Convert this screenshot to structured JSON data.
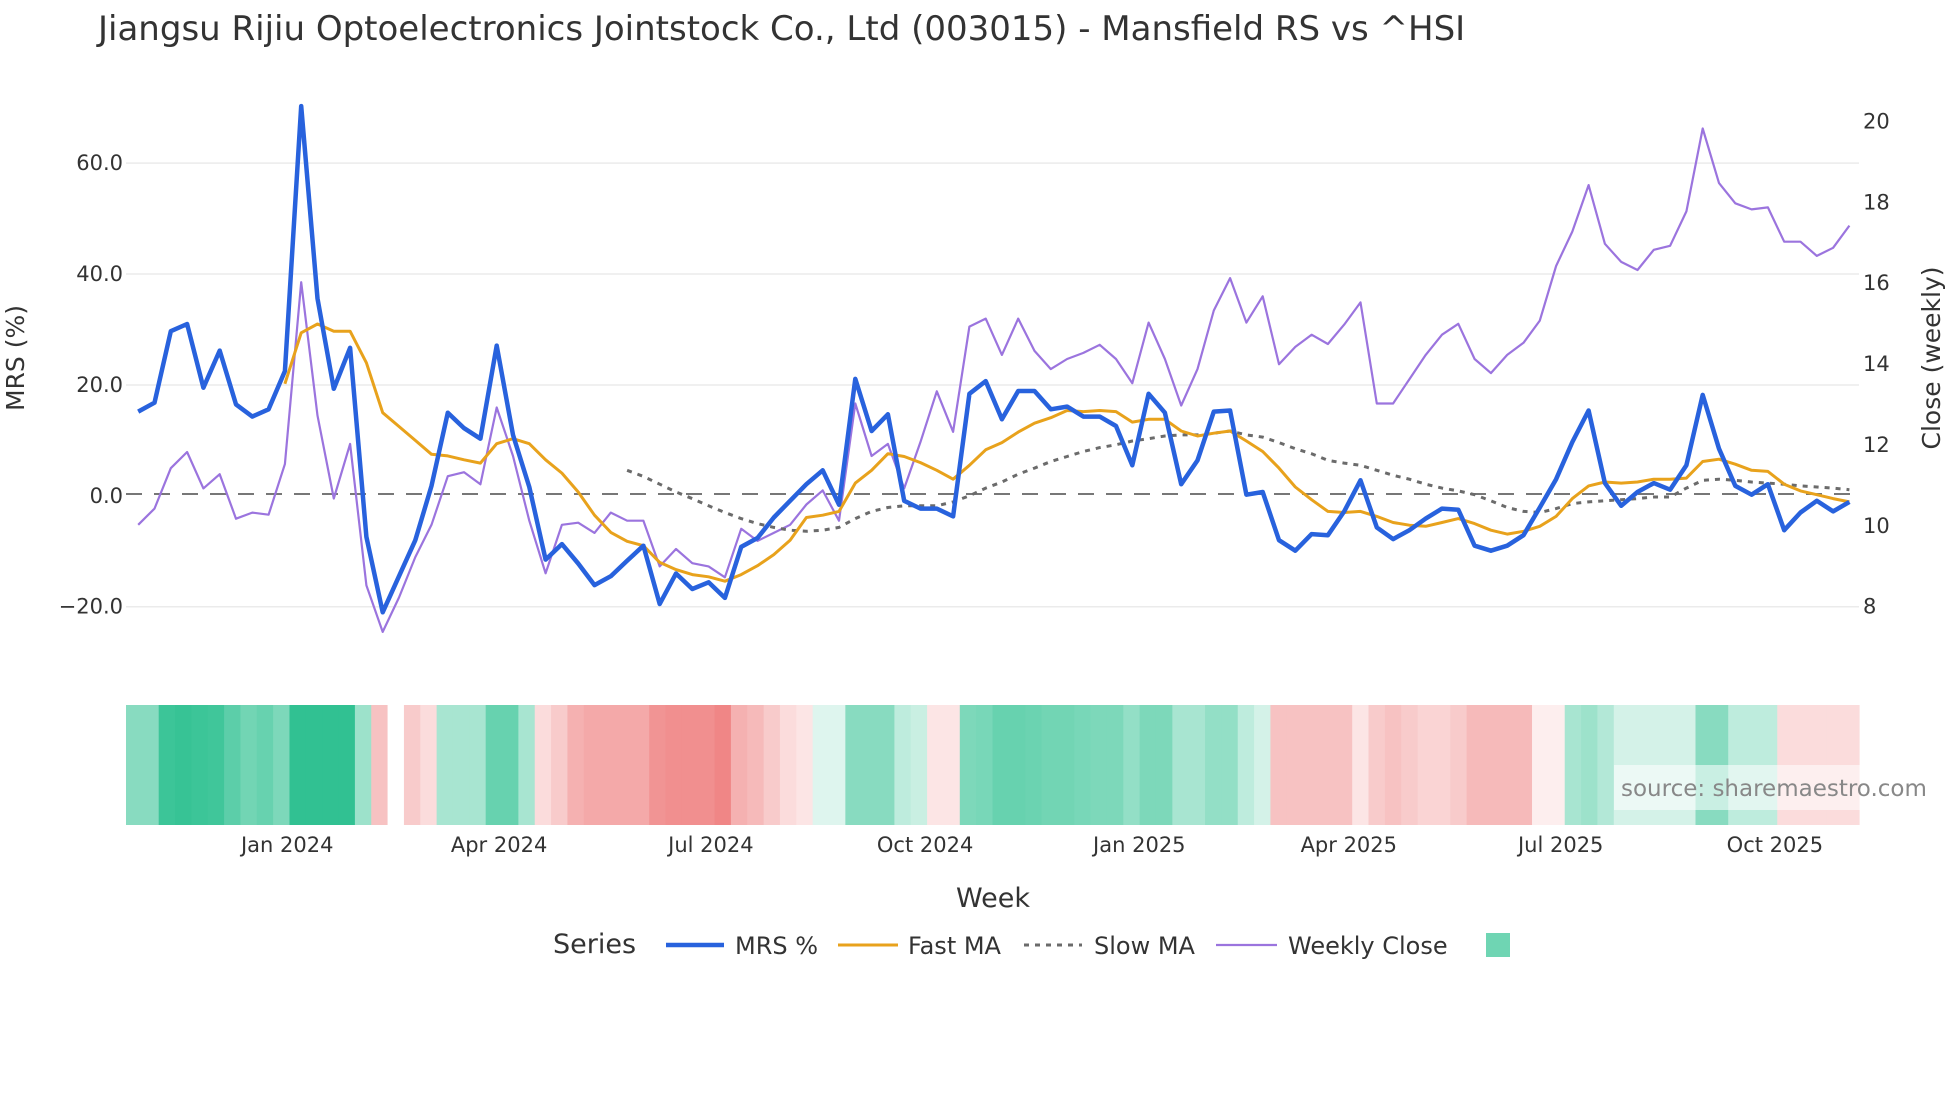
{
  "chart_data": {
    "type": "line",
    "title": "Jiangsu Rijiu Optoelectronics Jointstock Co., Ltd (003015) - Mansfield RS vs ^HSI",
    "xlabel": "Week",
    "ylabel": "MRS (%)",
    "y2label": "Close (weekly)",
    "x_start": "2023-10-29",
    "x_step_days": 7,
    "ylim": [
      -26,
      75
    ],
    "y2lim": [
      7.15,
      21.0
    ],
    "yticks": [
      -20,
      0,
      20,
      40,
      60
    ],
    "ytick_labels": [
      "−20.0",
      "0.0",
      "20.0",
      "40.0",
      "60.0"
    ],
    "y2ticks": [
      8,
      10,
      12,
      14,
      16,
      18,
      20
    ],
    "y2tick_labels": [
      "8",
      "10",
      "12",
      "14",
      "16",
      "18",
      "20"
    ],
    "xticks": [
      {
        "date": "2024-01-01",
        "label": "Jan 2024"
      },
      {
        "date": "2024-04-01",
        "label": "Apr 2024"
      },
      {
        "date": "2024-07-01",
        "label": "Jul 2024"
      },
      {
        "date": "2024-10-01",
        "label": "Oct 2024"
      },
      {
        "date": "2025-01-01",
        "label": "Jan 2025"
      },
      {
        "date": "2025-04-01",
        "label": "Apr 2025"
      },
      {
        "date": "2025-07-01",
        "label": "Jul 2025"
      },
      {
        "date": "2025-10-01",
        "label": "Oct 2025"
      }
    ],
    "grid": true,
    "zero_line": 0,
    "legend_title": "Series",
    "legend_position": "bottom",
    "series": [
      {
        "name": "MRS %",
        "axis": "left",
        "color": "#2862dd",
        "style": "solid",
        "values": [
          15.2,
          16.8,
          29.7,
          31,
          19.5,
          26.2,
          16.5,
          14.3,
          15.6,
          22.5,
          70.3,
          35.6,
          19.3,
          26.7,
          -7.4,
          -21,
          -14.5,
          -8,
          1.8,
          15,
          12.2,
          10.3,
          27.1,
          11,
          1.6,
          -11.5,
          -8.7,
          -12.2,
          -16.1,
          -14.5,
          -11.7,
          -9,
          -19.5,
          -14,
          -16.8,
          -15.6,
          -18.4,
          -9.2,
          -7.6,
          -3.9,
          -0.9,
          2.1,
          4.6,
          -1.6,
          21.1,
          11.7,
          14.7,
          -0.9,
          -2.3,
          -2.3,
          -3.7,
          18.4,
          20.7,
          13.8,
          18.9,
          18.9,
          15.6,
          16.1,
          14.3,
          14.3,
          12.6,
          5.5,
          18.4,
          15,
          2.1,
          6.4,
          15.2,
          15.4,
          0.2,
          0.7,
          -8,
          -9.9,
          -6.9,
          -7.1,
          -2.8,
          2.8,
          -5.7,
          -7.8,
          -6.2,
          -4.1,
          -2.3,
          -2.5,
          -9,
          -9.9,
          -9,
          -7.1,
          -2.1,
          3,
          9.7,
          15.4,
          2.3,
          -1.8,
          0.7,
          2.3,
          1.1,
          5.5,
          18.2,
          8.5,
          1.8,
          0.2,
          2.1,
          -6.2,
          -3,
          -0.9,
          -2.8,
          -1.1
        ]
      },
      {
        "name": "Fast MA",
        "axis": "left",
        "color": "#e8a21c",
        "style": "solid",
        "start_index": 9,
        "values": [
          20.2,
          29.4,
          31,
          29.7,
          29.7,
          24,
          15,
          12.5,
          10,
          7.5,
          7.2,
          6.5,
          5.9,
          9.4,
          10.3,
          9.4,
          6.5,
          4.1,
          0.7,
          -3.5,
          -6.6,
          -8.2,
          -9,
          -12,
          -13.3,
          -14.2,
          -14.6,
          -15.4,
          -14.2,
          -12.6,
          -10.6,
          -8,
          -3.9,
          -3.5,
          -2.8,
          2.3,
          4.6,
          7.6,
          7.1,
          6.0,
          4.6,
          3.0,
          5.5,
          8.3,
          9.6,
          11.5,
          13.1,
          14.1,
          15.4,
          15.2,
          15.4,
          15.2,
          13.3,
          13.8,
          13.8,
          11.7,
          10.8,
          11.3,
          11.7,
          9.9,
          8.0,
          5.0,
          1.6,
          -0.7,
          -2.8,
          -3.0,
          -2.8,
          -3.7,
          -4.8,
          -5.3,
          -5.5,
          -4.8,
          -4.1,
          -5.0,
          -6.2,
          -6.9,
          -6.4,
          -5.5,
          -3.7,
          -0.5,
          1.8,
          2.5,
          2.3,
          2.5,
          3.0,
          3.0,
          3.2,
          6.2,
          6.6,
          5.7,
          4.6,
          4.4,
          2.1,
          0.9,
          0.2,
          -0.5,
          -1.1
        ]
      },
      {
        "name": "Slow MA",
        "axis": "left",
        "color": "#6b6b6b",
        "style": "dotted",
        "start_index": 30,
        "values": [
          4.6,
          3.5,
          2.1,
          0.7,
          -0.5,
          -1.8,
          -3.0,
          -4.1,
          -5.0,
          -5.7,
          -6.2,
          -6.4,
          -6.2,
          -5.7,
          -4.1,
          -2.8,
          -2.1,
          -1.8,
          -1.8,
          -1.8,
          -1.1,
          0,
          1.4,
          2.5,
          3.9,
          5.0,
          6.2,
          7.1,
          8.0,
          8.7,
          9.2,
          9.9,
          10.3,
          10.8,
          11.0,
          11.0,
          11.3,
          11.7,
          11.0,
          10.6,
          9.6,
          8.5,
          7.6,
          6.4,
          5.9,
          5.5,
          4.6,
          3.7,
          3.0,
          2.1,
          1.4,
          0.9,
          0.2,
          -0.9,
          -2.1,
          -2.8,
          -3.0,
          -2.3,
          -1.4,
          -1.1,
          -0.9,
          -0.7,
          -0.5,
          -0.2,
          -0.2,
          1.4,
          2.8,
          3.0,
          2.8,
          2.5,
          2.3,
          2.1,
          1.8,
          1.6,
          1.4,
          1.1
        ]
      },
      {
        "name": "Weekly Close",
        "axis": "right",
        "color": "#9b74de",
        "style": "solid",
        "values": [
          10.0,
          10.4,
          11.4,
          11.8,
          10.9,
          11.25,
          10.15,
          10.3,
          10.25,
          11.5,
          16,
          12.7,
          10.65,
          12,
          8.5,
          7.35,
          8.2,
          9.2,
          10,
          11.2,
          11.3,
          11,
          12.9,
          11.7,
          10.1,
          8.8,
          10,
          10.05,
          9.8,
          10.3,
          10.1,
          10.1,
          8.97,
          9.4,
          9.05,
          8.97,
          8.7,
          9.9,
          9.6,
          9.8,
          10.0,
          10.5,
          10.85,
          10.1,
          13.0,
          11.7,
          12,
          10.9,
          12.05,
          13.3,
          12.3,
          14.9,
          15.1,
          14.2,
          15.1,
          14.3,
          13.85,
          14.1,
          14.25,
          14.45,
          14.1,
          13.5,
          15.0,
          14.1,
          12.95,
          13.85,
          15.3,
          16.1,
          15.0,
          15.65,
          13.97,
          14.4,
          14.7,
          14.47,
          14.95,
          15.5,
          13.0,
          13.0,
          13.6,
          14.2,
          14.7,
          14.97,
          14.1,
          13.75,
          14.2,
          14.5,
          15.05,
          16.4,
          17.25,
          18.4,
          16.95,
          16.5,
          16.3,
          16.8,
          16.9,
          17.75,
          19.8,
          18.45,
          17.95,
          17.8,
          17.85,
          17.0,
          17.0,
          16.65,
          16.85,
          17.4
        ]
      }
    ],
    "heatmap": {
      "positive_color": "#26be8c",
      "negative_color": "#e95252",
      "values": [
        0.55,
        0.55,
        0.9,
        0.92,
        0.9,
        0.88,
        0.75,
        0.65,
        0.7,
        0.6,
        0.95,
        0.95,
        0.95,
        0.95,
        0.45,
        -0.35,
        0,
        -0.3,
        -0.2,
        0.4,
        0.4,
        0.4,
        0.7,
        0.7,
        0.4,
        -0.2,
        -0.3,
        -0.45,
        -0.5,
        -0.5,
        -0.5,
        -0.5,
        -0.62,
        -0.65,
        -0.65,
        -0.65,
        -0.7,
        -0.45,
        -0.4,
        -0.3,
        -0.2,
        -0.15,
        0.15,
        0.15,
        0.55,
        0.55,
        0.55,
        0.3,
        0.25,
        -0.15,
        -0.15,
        0.6,
        0.62,
        0.7,
        0.7,
        0.68,
        0.65,
        0.65,
        0.62,
        0.6,
        0.6,
        0.5,
        0.6,
        0.6,
        0.4,
        0.4,
        0.5,
        0.5,
        0.3,
        0.2,
        -0.35,
        -0.35,
        -0.35,
        -0.35,
        -0.35,
        -0.15,
        -0.3,
        -0.35,
        -0.3,
        -0.25,
        -0.25,
        -0.3,
        -0.4,
        -0.4,
        -0.4,
        -0.4,
        -0.1,
        -0.1,
        0.4,
        0.45,
        0.35,
        0.2,
        0.2,
        0.2,
        0.2,
        0.2,
        0.55,
        0.55,
        0.3,
        0.3,
        0.3,
        -0.2,
        -0.2,
        -0.2,
        -0.2,
        -0.2
      ]
    },
    "source": "source: sharemaestro.com"
  }
}
